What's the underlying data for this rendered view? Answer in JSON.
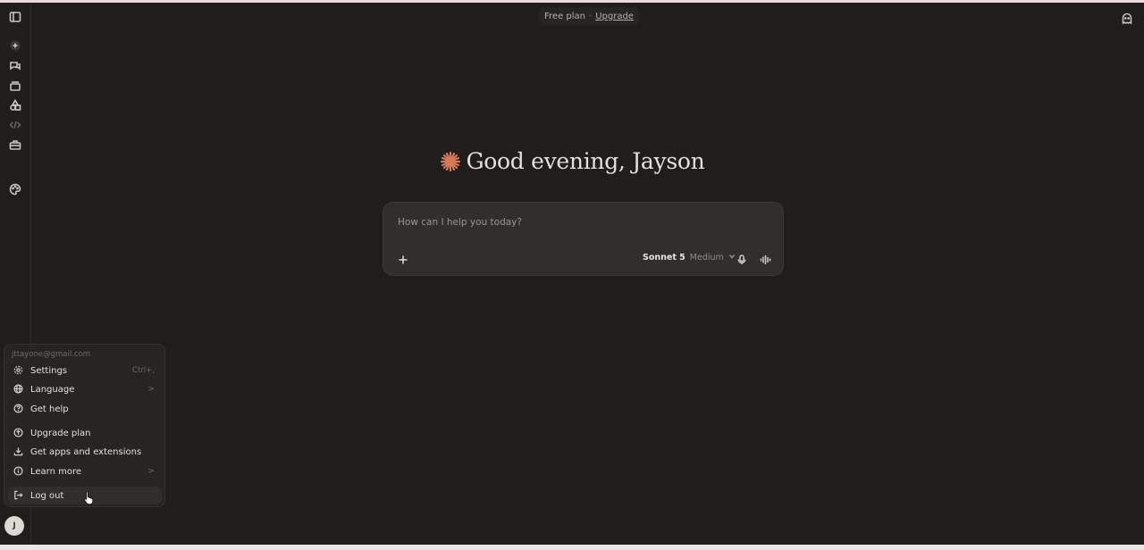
{
  "header": {
    "plan_label": "Free plan",
    "separator": "·",
    "upgrade_label": "Upgrade"
  },
  "greeting": {
    "text": "Good evening, Jayson"
  },
  "composer": {
    "placeholder": "How can I help you today?",
    "model_name": "Sonnet 5",
    "model_effort": "Medium"
  },
  "account_menu": {
    "email": "jttayone@gmail.com",
    "items": [
      {
        "label": "Settings",
        "hint": "Ctrl+,",
        "icon": "gear-icon"
      },
      {
        "label": "Language",
        "hint": ">",
        "icon": "globe-icon"
      },
      {
        "label": "Get help",
        "icon": "help-circle-icon"
      },
      {
        "label": "Upgrade plan",
        "icon": "arrow-up-circle-icon"
      },
      {
        "label": "Get apps and extensions",
        "icon": "download-icon"
      },
      {
        "label": "Learn more",
        "hint": ">",
        "icon": "info-icon"
      },
      {
        "label": "Log out",
        "icon": "logout-icon"
      }
    ]
  },
  "avatar": {
    "initial": "J"
  },
  "colors": {
    "background": "#1f1e1d",
    "accent": "#d97757",
    "composer": "#302f2c",
    "menu": "#262523"
  }
}
